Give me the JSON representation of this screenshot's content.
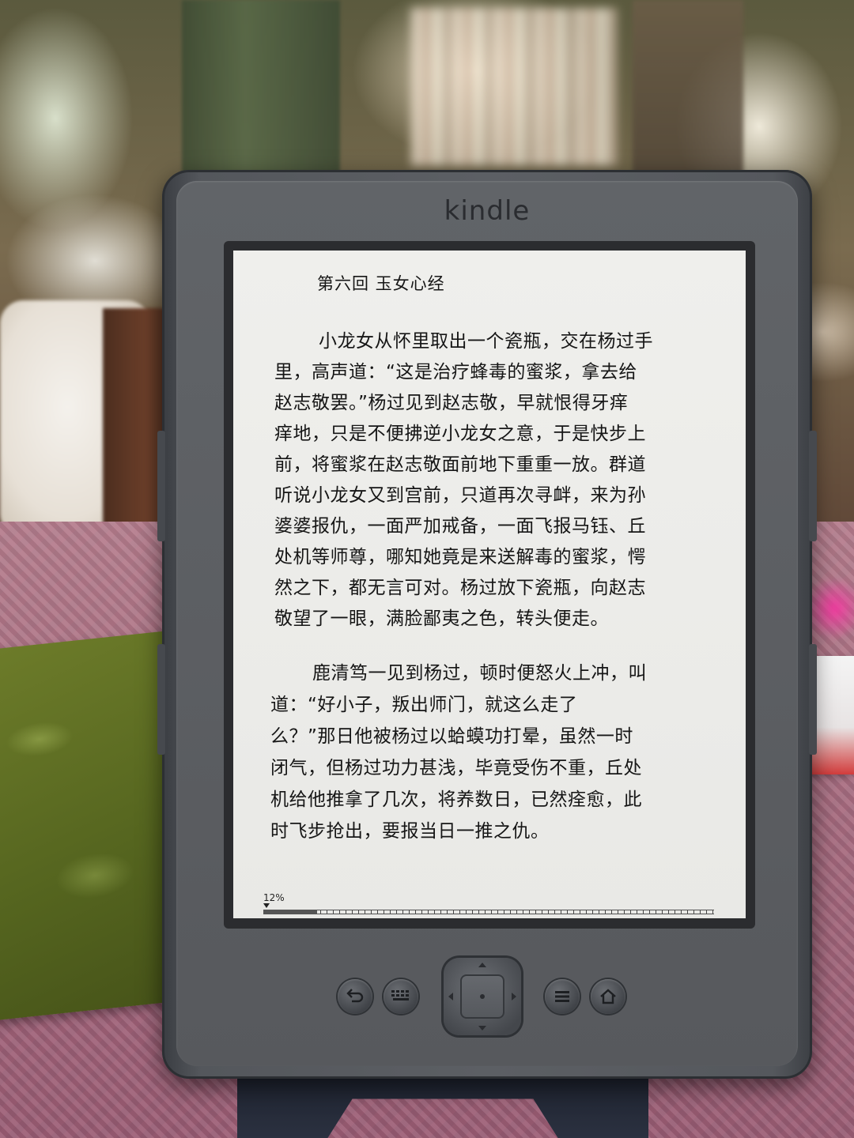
{
  "device": {
    "brand": "kindle"
  },
  "reader": {
    "chapter_title": "第六回 玉女心经",
    "lines": [
      "小龙女从怀里取出一个瓷瓶，交在杨过手",
      "里，高声道：“这是治疗蜂毒的蜜浆，拿去给",
      "赵志敬罢。”杨过见到赵志敬，早就恨得牙痒",
      "痒地，只是不便拂逆小龙女之意，于是快步上",
      "前，将蜜浆在赵志敬面前地下重重一放。群道",
      "听说小龙女又到宫前，只道再次寻衅，来为孙",
      "婆婆报仇，一面严加戒备，一面飞报马钰、丘",
      "处机等师尊，哪知她竟是来送解毒的蜜浆，愕",
      "然之下，都无言可对。杨过放下瓷瓶，向赵志",
      "敬望了一眼，满脸鄙夷之色，转头便走。",
      "鹿清笃一见到杨过，顿时便怒火上冲，叫",
      "道：“好小子，叛出师门，就这么走了",
      "么？”那日他被杨过以蛤蟆功打晕，虽然一时",
      "闭气，但杨过功力甚浅，毕竟受伤不重，丘处",
      "机给他推拿了几次，将养数日，已然痊愈，此",
      "时飞步抢出，要报当日一推之仇。"
    ],
    "progress_label": "12%",
    "progress_value": 0.12
  },
  "controls": {
    "back_icon": "back-arrow-icon",
    "keyboard_icon": "keyboard-icon",
    "menu_icon": "menu-icon",
    "home_icon": "home-icon",
    "dpad_icon": "five-way-controller"
  },
  "colors": {
    "device_body": "#5c5f64",
    "screen_bg": "#efefec",
    "text": "#161616"
  }
}
